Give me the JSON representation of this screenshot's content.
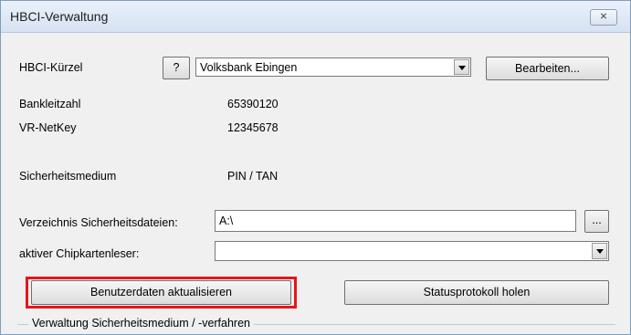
{
  "window": {
    "title": "HBCI-Verwaltung",
    "close_label": "⨯"
  },
  "hbci": {
    "kuerzel_label": "HBCI-Kürzel",
    "help_label": "?",
    "selected_bank": "Volksbank Ebingen",
    "edit_label": "Bearbeiten..."
  },
  "info": {
    "blz_label": "Bankleitzahl",
    "blz_value": "65390120",
    "netkey_label": "VR-NetKey",
    "netkey_value": "12345678",
    "medium_label": "Sicherheitsmedium",
    "medium_value": "PIN / TAN"
  },
  "settings": {
    "dir_label": "Verzeichnis Sicherheitsdateien:",
    "dir_value": "A:\\",
    "browse_label": "...",
    "reader_label": "aktiver Chipkartenleser:",
    "reader_value": ""
  },
  "actions": {
    "update_label": "Benutzerdaten aktualisieren",
    "status_label": "Statusprotokoll holen"
  },
  "group": {
    "label": "Verwaltung Sicherheitsmedium / -verfahren"
  },
  "colors": {
    "highlight": "#e8141e",
    "titlebar": "#dce7f5"
  }
}
